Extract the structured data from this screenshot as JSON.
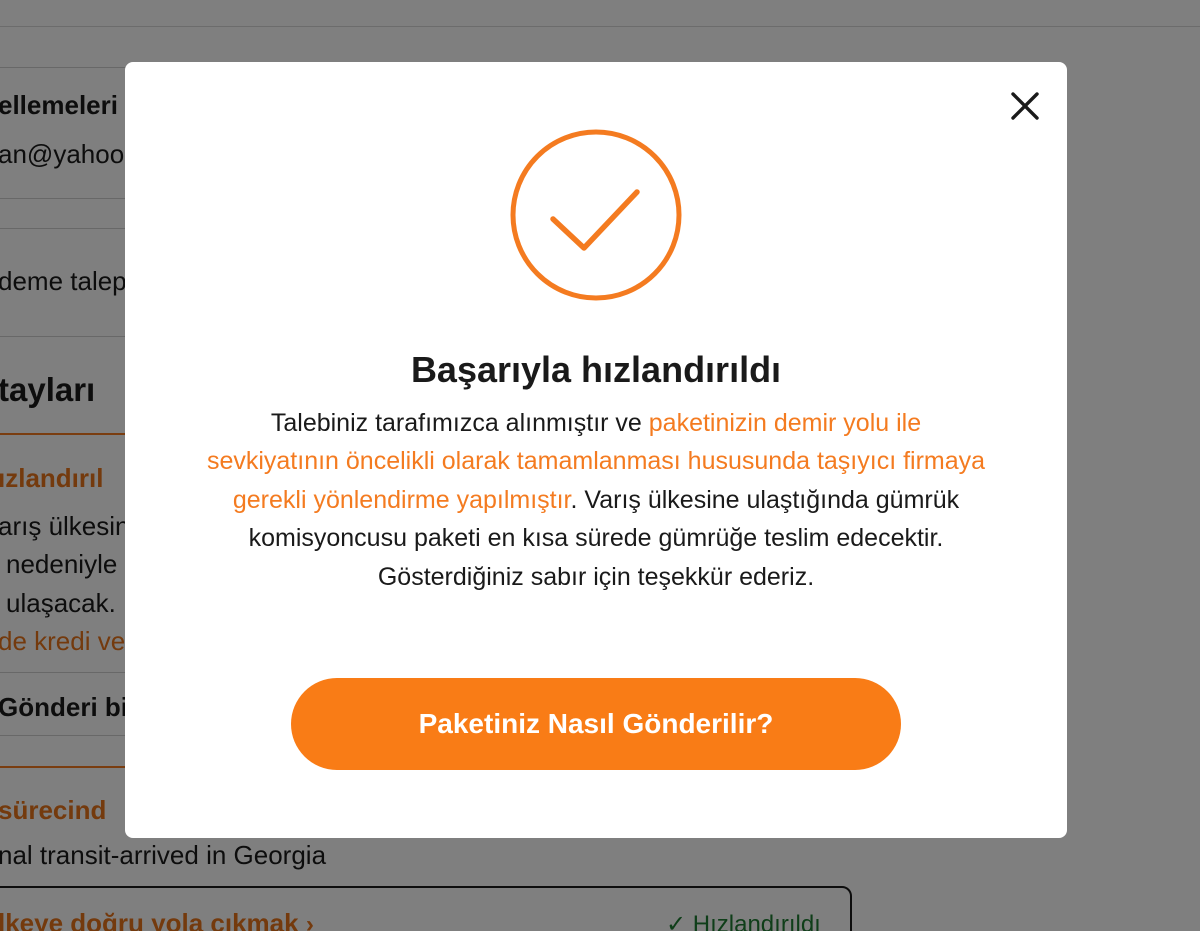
{
  "background": {
    "section1_title": "ellemeleri",
    "section1_email": "an@yahoo.",
    "section2_text": "deme talep",
    "section3_title": "tayları",
    "orange_heading": "ızlandırıl",
    "line1": "arış ülkesin",
    "line2": "nedeniyle",
    "line3": "ulaşacak.",
    "orange_link": "de kredi ve",
    "sub_heading": "Gönderi bi",
    "process_heading": "sürecind",
    "transit_text": "nal transit-arrived in Georgia",
    "step_label": "lkeye doğru yola çıkmak",
    "step_chevron": "›",
    "step_status_check": "✓",
    "step_status": "Hızlandırıldı"
  },
  "modal": {
    "close_icon": "close-icon",
    "success_icon": "check-circle-icon",
    "title": "Başarıyla hızlandırıldı",
    "body_part1": "Talebiniz tarafımızca alınmıştır ve ",
    "body_highlight": "paketinizin demir yolu ile sevkiyatının öncelikli olarak tamamlanması hususunda taşıyıcı firmaya gerekli yönlendirme yapılmıştır",
    "body_part2": ". Varış ülkesine ulaştığında gümrük komisyoncusu paketi en kısa sürede gümrüğe teslim edecektir. Gösterdiğiniz sabır için teşekkür ederiz.",
    "button_label": "Paketiniz Nasıl Gönderilir?"
  },
  "colors": {
    "accent": "#f97c16",
    "highlight_text": "#f47b20",
    "overlay": "rgba(0,0,0,0.5)",
    "status_green": "#1e7d32"
  }
}
